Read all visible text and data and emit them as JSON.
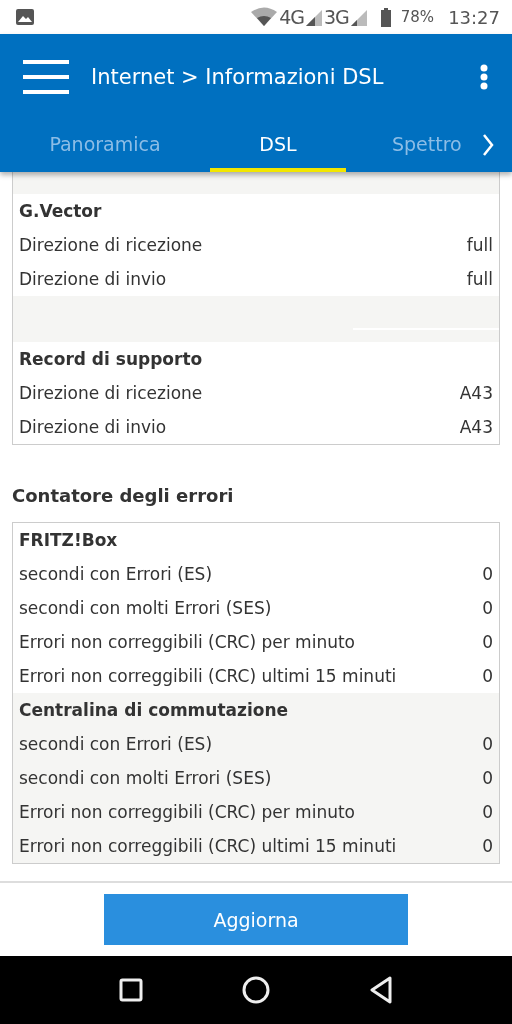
{
  "status_bar": {
    "network_1": "4G",
    "network_2": "3G",
    "battery": "78%",
    "time": "13:27"
  },
  "app_bar": {
    "title": "Internet > Informazioni DSL"
  },
  "tabs": [
    {
      "label": "Panoramica",
      "selected": false
    },
    {
      "label": "DSL",
      "selected": true
    },
    {
      "label": "Spettro",
      "selected": false
    }
  ],
  "cards": [
    {
      "groups": [
        {
          "title": "G.Vector",
          "shaded": false,
          "rows": [
            {
              "label": "Direzione di ricezione",
              "value": "full"
            },
            {
              "label": "Direzione di invio",
              "value": "full"
            }
          ]
        },
        {
          "title": "Record di supporto",
          "shaded": false,
          "rows": [
            {
              "label": "Direzione di ricezione",
              "value": "A43"
            },
            {
              "label": "Direzione di invio",
              "value": "A43"
            }
          ]
        }
      ]
    },
    {
      "heading": "Contatore degli errori",
      "groups": [
        {
          "title": "FRITZ!Box",
          "shaded": false,
          "rows": [
            {
              "label": "secondi con Errori (ES)",
              "value": "0"
            },
            {
              "label": "secondi con molti Errori (SES)",
              "value": "0"
            },
            {
              "label": "Errori non correggibili (CRC) per minuto",
              "value": "0"
            },
            {
              "label": "Errori non correggibili (CRC) ultimi 15 minuti",
              "value": "0"
            }
          ]
        },
        {
          "title": "Centralina di commutazione",
          "shaded": true,
          "rows": [
            {
              "label": "secondi con Errori (ES)",
              "value": "0"
            },
            {
              "label": "secondi con molti Errori (SES)",
              "value": "0"
            },
            {
              "label": "Errori non correggibili (CRC) per minuto",
              "value": "0"
            },
            {
              "label": "Errori non correggibili (CRC) ultimi 15 minuti",
              "value": "0"
            }
          ]
        }
      ]
    }
  ],
  "footer": {
    "button": "Aggiorna"
  }
}
